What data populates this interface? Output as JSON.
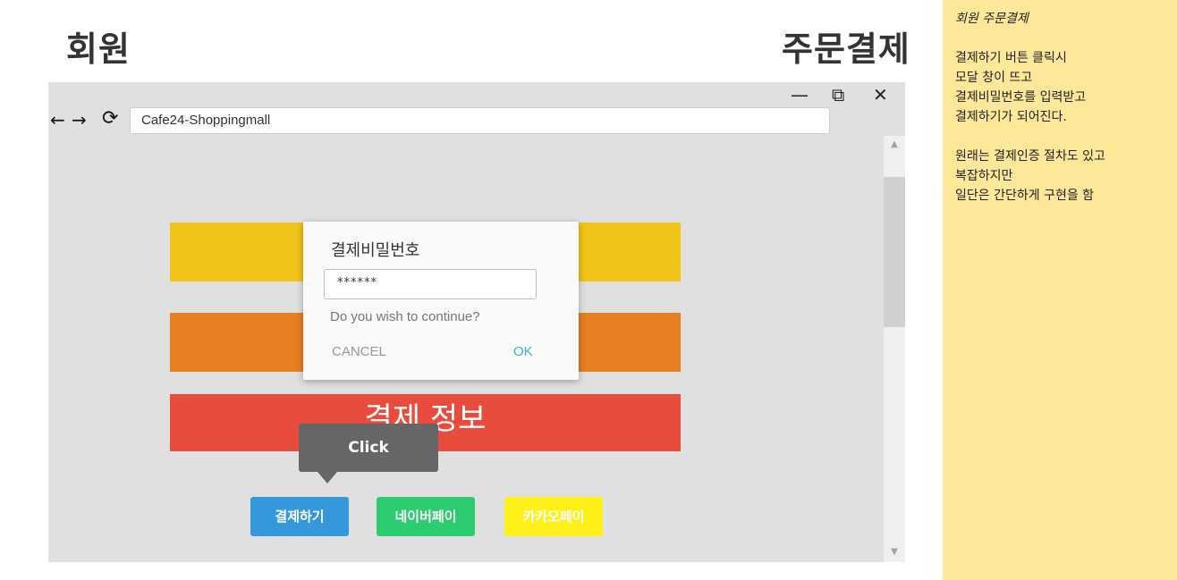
{
  "titles": {
    "left": "회원",
    "right": "주문결제"
  },
  "browser": {
    "address": "Cafe24-Shoppingmall",
    "icons": {
      "minimize": "minimize-icon",
      "maximize": "maximize-icon",
      "close": "close-icon",
      "back": "back-arrow-icon",
      "forward": "forward-arrow-icon",
      "reload": "reload-icon"
    }
  },
  "page": {
    "section_title": "결제 정보",
    "bar_colors": [
      "#f0c419",
      "#e67e22",
      "#e74c3c"
    ]
  },
  "modal": {
    "title": "결제비밀번호",
    "password_value": "******",
    "message": "Do you wish to continue?",
    "cancel_label": "CANCEL",
    "ok_label": "OK"
  },
  "tooltip": {
    "label": "Click"
  },
  "buttons": {
    "pay": "결제하기",
    "naver": "네이버페이",
    "kakao": "카카오페이"
  },
  "note": {
    "title": "회원 주문결제",
    "lines": [
      "결제하기 버튼 클릭시",
      "모달 창이 뜨고",
      "결제비밀번호를 입력받고",
      "결제하기가 되어진다.",
      "",
      "원래는 결제인증 절차도 있고",
      "복잡하지만",
      "일단은 간단하게 구현을 함"
    ]
  }
}
